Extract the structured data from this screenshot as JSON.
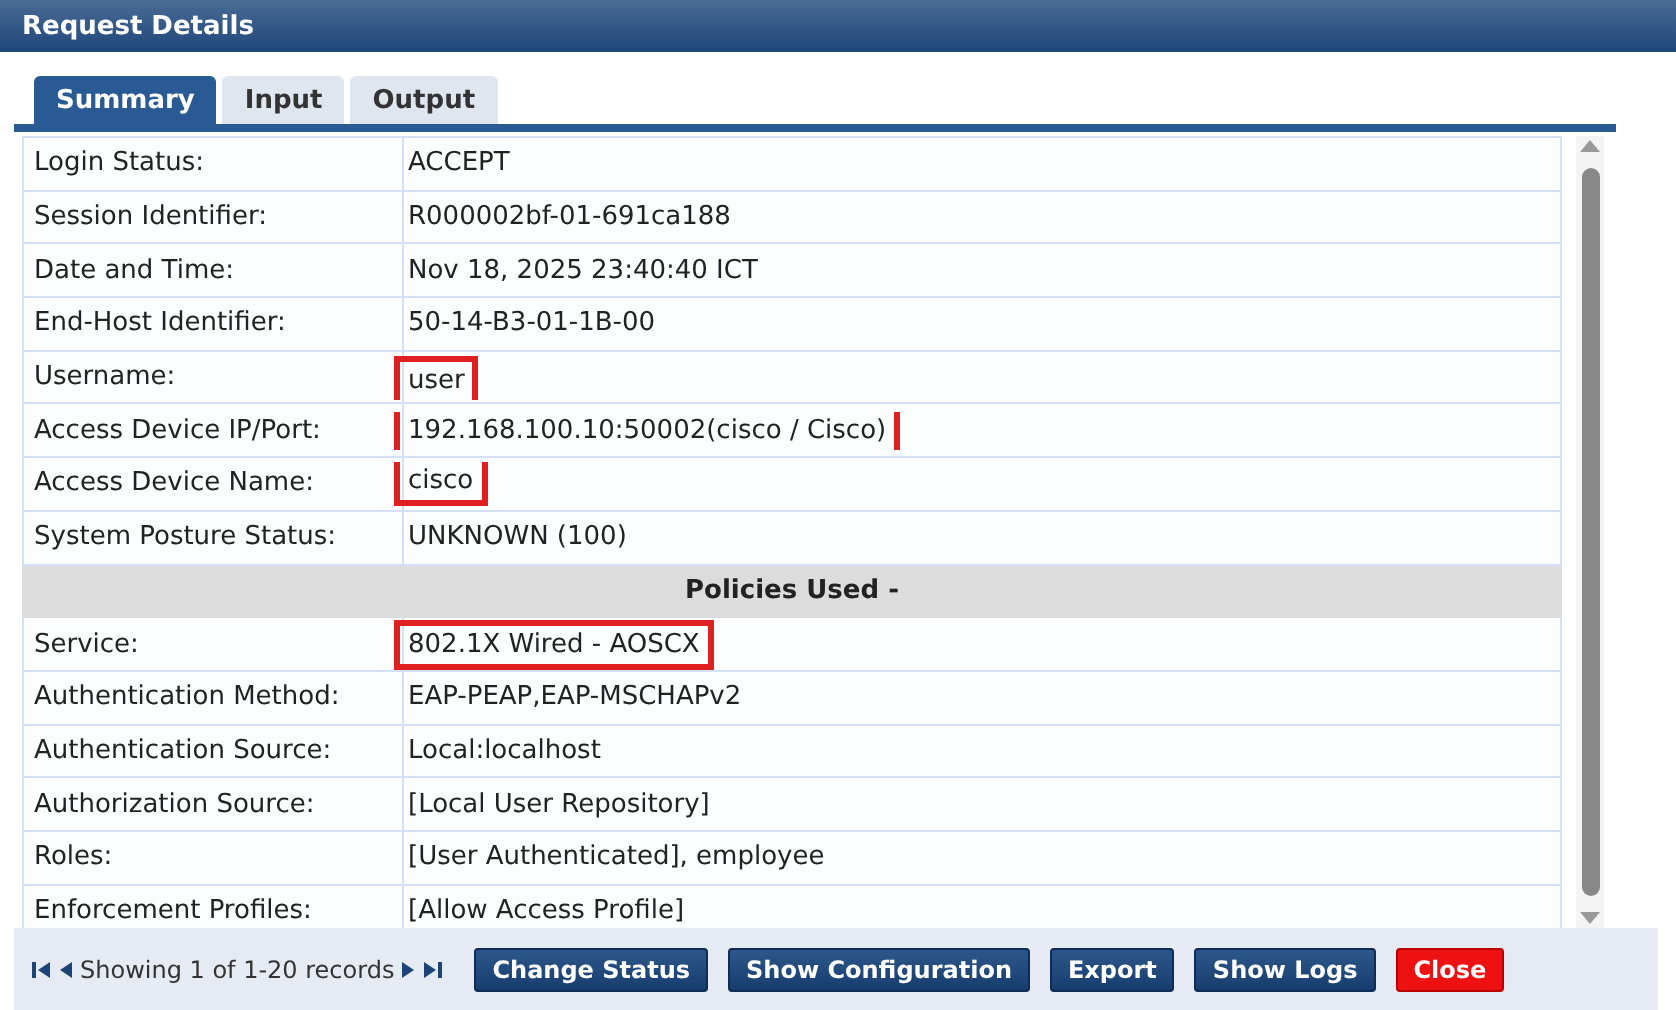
{
  "window": {
    "title": "Request Details"
  },
  "tabs": [
    {
      "label": "Summary",
      "selected": true
    },
    {
      "label": "Input",
      "selected": false
    },
    {
      "label": "Output",
      "selected": false
    }
  ],
  "rows": [
    {
      "kind": "field",
      "label": "Login Status:",
      "value": "ACCEPT",
      "highlighted": false
    },
    {
      "kind": "field",
      "label": "Session Identifier:",
      "value": "R000002bf-01-691ca188",
      "highlighted": false
    },
    {
      "kind": "field",
      "label": "Date and Time:",
      "value": "Nov 18, 2025 23:40:40 ICT",
      "highlighted": false
    },
    {
      "kind": "field",
      "label": "End-Host Identifier:",
      "value": "50-14-B3-01-1B-00",
      "highlighted": false
    },
    {
      "kind": "field",
      "label": "Username:",
      "value": "user",
      "highlighted": true
    },
    {
      "kind": "field",
      "label": "Access Device IP/Port:",
      "value": "192.168.100.10:50002(cisco / Cisco)",
      "highlighted": true
    },
    {
      "kind": "field",
      "label": "Access Device Name:",
      "value": "cisco",
      "highlighted": true
    },
    {
      "kind": "field",
      "label": "System Posture Status:",
      "value": "UNKNOWN (100)",
      "highlighted": false
    },
    {
      "kind": "section",
      "label": "Policies Used -"
    },
    {
      "kind": "field",
      "label": "Service:",
      "value": "802.1X Wired - AOSCX",
      "highlighted": true
    },
    {
      "kind": "field",
      "label": "Authentication Method:",
      "value": "EAP-PEAP,EAP-MSCHAPv2",
      "highlighted": false
    },
    {
      "kind": "field",
      "label": "Authentication Source:",
      "value": "Local:localhost",
      "highlighted": false
    },
    {
      "kind": "field",
      "label": "Authorization Source:",
      "value": "[Local User Repository]",
      "highlighted": false
    },
    {
      "kind": "field",
      "label": "Roles:",
      "value": "[User Authenticated], employee",
      "highlighted": false
    },
    {
      "kind": "field",
      "label": "Enforcement Profiles:",
      "value": "[Allow Access Profile]",
      "highlighted": false
    }
  ],
  "pager": {
    "text": "Showing 1 of 1-20 records"
  },
  "buttons": [
    {
      "label": "Change Status",
      "kind": "normal"
    },
    {
      "label": "Show Configuration",
      "kind": "normal"
    },
    {
      "label": "Export",
      "kind": "normal"
    },
    {
      "label": "Show Logs",
      "kind": "normal"
    },
    {
      "label": "Close",
      "kind": "danger"
    }
  ]
}
